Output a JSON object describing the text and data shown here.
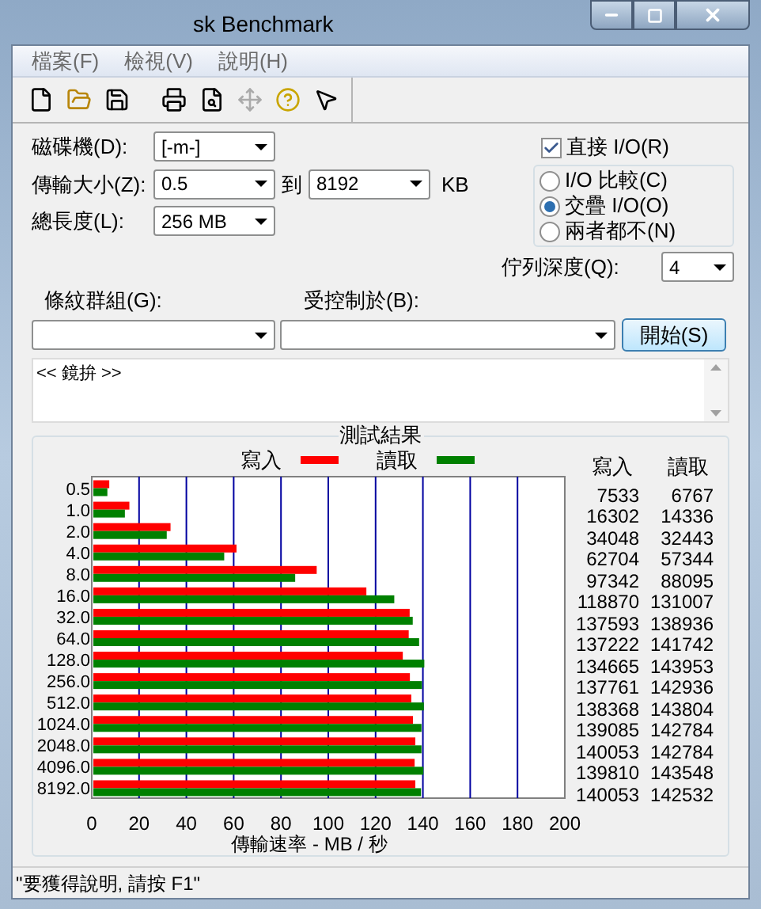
{
  "window": {
    "title": "sk Benchmark"
  },
  "menu": [
    "檔案(F)",
    "檢視(V)",
    "說明(H)"
  ],
  "form": {
    "drive": {
      "label": "磁碟機(D):",
      "value": "[-m-]"
    },
    "transfer_size": {
      "label": "傳輸大小(Z):",
      "from": "0.5",
      "to_label": "到",
      "to": "8192",
      "unit": "KB"
    },
    "total_length": {
      "label": "總長度(L):",
      "value": "256 MB"
    },
    "direct_io": {
      "label": "直接 I/O(R)",
      "checked": true
    },
    "io_modes": [
      {
        "label": "I/O 比較(C)",
        "selected": false
      },
      {
        "label": "交疊 I/O(O)",
        "selected": true
      },
      {
        "label": "兩者都不(N)",
        "selected": false
      }
    ],
    "queue_depth": {
      "label": "佇列深度(Q):",
      "value": "4"
    },
    "stripe_group": {
      "label": "條紋群組(G):"
    },
    "controlled_by": {
      "label": "受控制於(B):"
    },
    "start_button": "開始(S)",
    "log": "<< 鏡拚 >>"
  },
  "results": {
    "title": "測試結果",
    "columns": [
      "寫入",
      "讀取"
    ],
    "rows": [
      {
        "write": "7533",
        "read": "6767"
      },
      {
        "write": "16302",
        "read": "14336"
      },
      {
        "write": "34048",
        "read": "32443"
      },
      {
        "write": "62704",
        "read": "57344"
      },
      {
        "write": "97342",
        "read": "88095"
      },
      {
        "write": "118870",
        "read": "131007"
      },
      {
        "write": "137593",
        "read": "138936"
      },
      {
        "write": "137222",
        "read": "141742"
      },
      {
        "write": "134665",
        "read": "143953"
      },
      {
        "write": "137761",
        "read": "142936"
      },
      {
        "write": "138368",
        "read": "143804"
      },
      {
        "write": "139085",
        "read": "142784"
      },
      {
        "write": "140053",
        "read": "142784"
      },
      {
        "write": "139810",
        "read": "143548"
      },
      {
        "write": "140053",
        "read": "142532"
      }
    ],
    "chart_data": {
      "type": "bar",
      "orientation": "horizontal",
      "grid": true,
      "legend": true,
      "xlabel": "傳輸速率 - MB / 秒",
      "xlim": [
        0,
        200
      ],
      "xticks": [
        0,
        20,
        40,
        60,
        80,
        100,
        120,
        140,
        160,
        180,
        200
      ],
      "categories": [
        "0.5",
        "1.0",
        "2.0",
        "4.0",
        "8.0",
        "16.0",
        "32.0",
        "64.0",
        "128.0",
        "256.0",
        "512.0",
        "1024.0",
        "2048.0",
        "4096.0",
        "8192.0"
      ],
      "series": [
        {
          "name": "寫入",
          "color": "#ff0000",
          "values": [
            7.4,
            15.9,
            33.3,
            61.2,
            95.1,
            116.1,
            134.4,
            134.0,
            131.5,
            134.5,
            135.1,
            135.8,
            136.8,
            136.5,
            136.8
          ]
        },
        {
          "name": "讀取",
          "color": "#008000",
          "values": [
            6.6,
            14.0,
            31.7,
            56.0,
            86.0,
            127.9,
            135.7,
            138.4,
            140.6,
            139.6,
            140.4,
            139.4,
            139.4,
            140.2,
            139.2
          ]
        }
      ]
    }
  },
  "status_bar": "\"要獲得說明, 請按 F1\""
}
